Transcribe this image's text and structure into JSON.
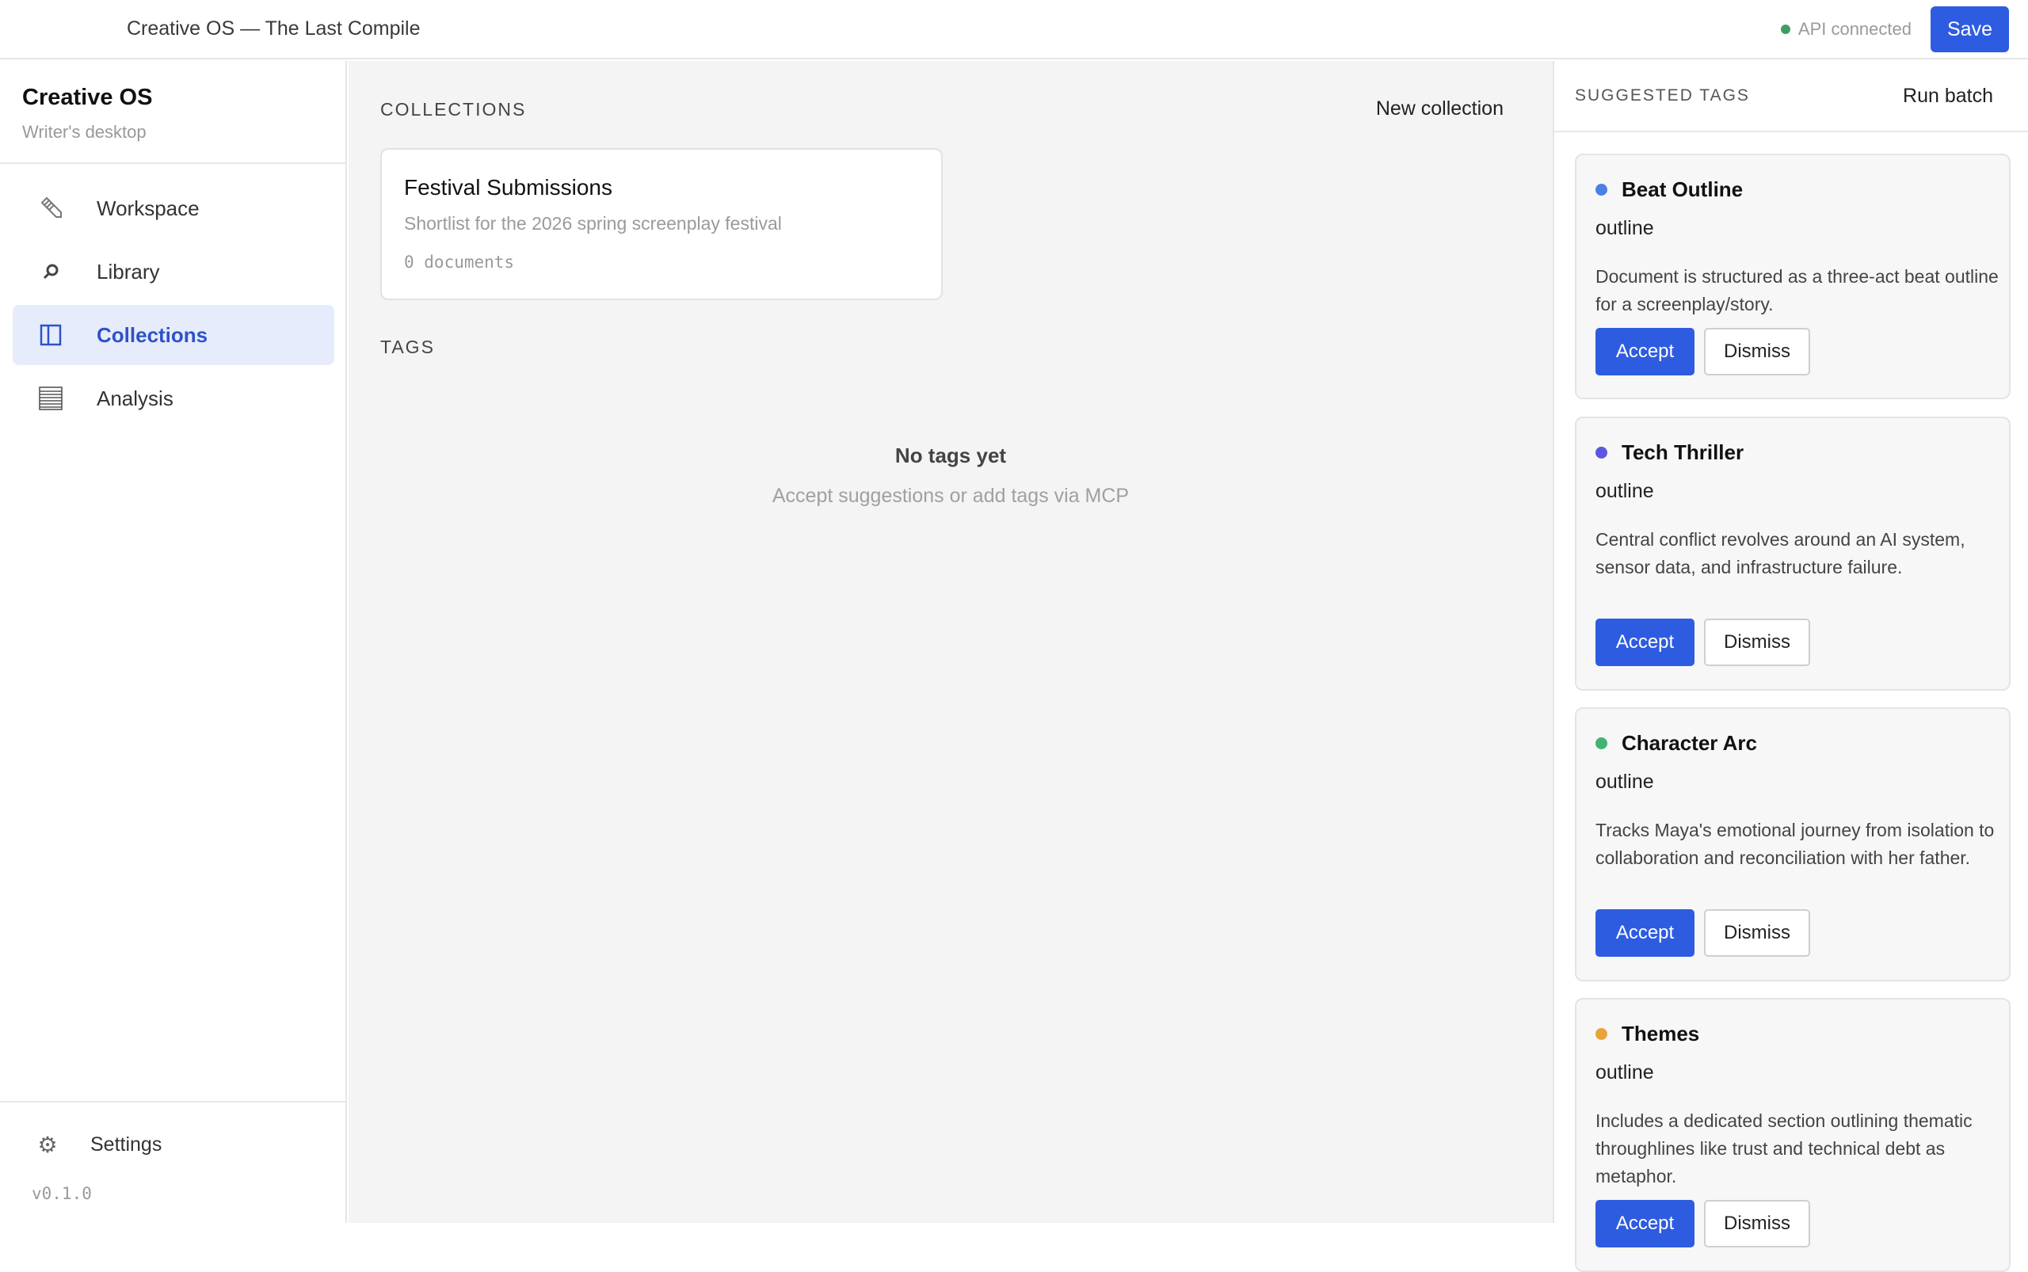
{
  "topbar": {
    "title": "Creative OS — The Last Compile",
    "api_status": "API connected",
    "save_label": "Save"
  },
  "sidebar": {
    "brand_title": "Creative OS",
    "brand_subtitle": "Writer's desktop",
    "items": [
      {
        "label": "Workspace",
        "icon": "pencil-icon",
        "active": false
      },
      {
        "label": "Library",
        "icon": "search-icon",
        "active": false
      },
      {
        "label": "Collections",
        "icon": "columns-icon",
        "active": true
      },
      {
        "label": "Analysis",
        "icon": "list-icon",
        "active": false
      }
    ],
    "settings_label": "Settings",
    "version": "v0.1.0"
  },
  "main": {
    "collections_label": "COLLECTIONS",
    "new_collection_label": "New collection",
    "collection": {
      "name": "Festival Submissions",
      "description": "Shortlist for the 2026 spring screenplay festival",
      "count": "0 documents"
    },
    "tags_label": "TAGS",
    "empty_title": "No tags yet",
    "empty_subtitle": "Accept suggestions or add tags via MCP"
  },
  "rightpanel": {
    "title": "SUGGESTED TAGS",
    "run_batch_label": "Run batch",
    "accept_label": "Accept",
    "dismiss_label": "Dismiss",
    "suggestions": [
      {
        "name": "Beat Outline",
        "type": "outline",
        "color": "#4a7fe6",
        "description": "Document is structured as a three-act beat outline for a screenplay/story."
      },
      {
        "name": "Tech Thriller",
        "type": "outline",
        "color": "#5b57e0",
        "description": "Central conflict revolves around an AI system, sensor data, and infrastructure failure."
      },
      {
        "name": "Character Arc",
        "type": "outline",
        "color": "#43b374",
        "description": "Tracks Maya's emotional journey from isolation to collaboration and reconciliation with her father."
      },
      {
        "name": "Themes",
        "type": "outline",
        "color": "#e8a33a",
        "description": "Includes a dedicated section outlining thematic throughlines like trust and technical debt as metaphor."
      }
    ]
  }
}
